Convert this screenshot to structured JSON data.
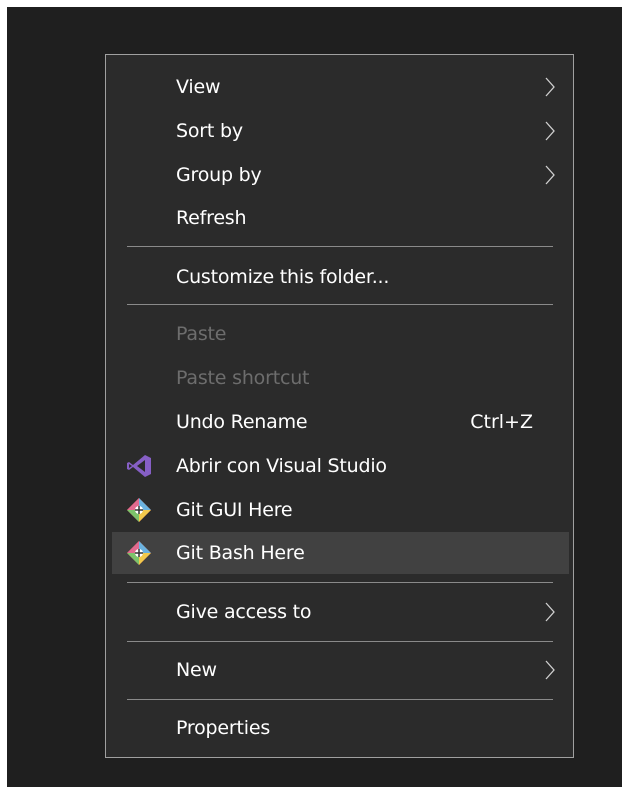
{
  "menu": {
    "items": [
      {
        "label": "View",
        "submenu": true
      },
      {
        "label": "Sort by",
        "submenu": true
      },
      {
        "label": "Group by",
        "submenu": true
      },
      {
        "label": "Refresh"
      },
      {
        "label": "Customize this folder..."
      },
      {
        "label": "Paste",
        "disabled": true
      },
      {
        "label": "Paste shortcut",
        "disabled": true
      },
      {
        "label": "Undo Rename",
        "shortcut": "Ctrl+Z"
      },
      {
        "label": "Abrir con Visual Studio",
        "icon": "visual-studio-icon"
      },
      {
        "label": "Git GUI Here",
        "icon": "git-icon"
      },
      {
        "label": "Git Bash Here",
        "icon": "git-icon",
        "highlighted": true
      },
      {
        "label": "Give access to",
        "submenu": true
      },
      {
        "label": "New",
        "submenu": true
      },
      {
        "label": "Properties"
      }
    ]
  },
  "colors": {
    "menu_background": "#2b2b2b",
    "hover_background": "#414141",
    "disabled_text": "#6d6d6d",
    "visual_studio_purple": "#865fc5",
    "git_orange": "#f05133"
  }
}
